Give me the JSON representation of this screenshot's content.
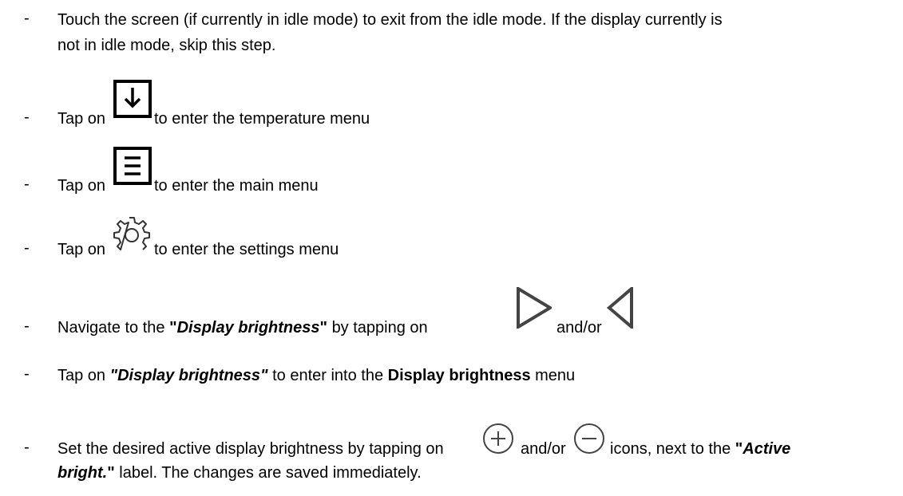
{
  "bullet": "-",
  "step1": {
    "line1": "Touch the screen (if currently in idle mode) to exit from the idle mode. If the display currently is",
    "line2": "not in idle mode, skip this step."
  },
  "step2": {
    "prefix": "Tap on",
    "suffix": "to enter the temperature menu",
    "icon": "arrow-down-box-icon"
  },
  "step3": {
    "prefix": "Tap on",
    "suffix": "to enter the main menu",
    "icon": "menu-box-icon"
  },
  "step4": {
    "prefix": "Tap on",
    "suffix": "to enter the settings menu",
    "icon": "gear-icon"
  },
  "step5": {
    "prefix": "Navigate to the",
    "quote_open": "\"",
    "emph": "Display brightness",
    "quote_close": "\"",
    "middle": "by tapping on",
    "and_or": "and/or",
    "icon_next": "triangle-right-icon",
    "icon_prev": "triangle-left-icon"
  },
  "step6": {
    "prefix": "Tap on",
    "emph": "\"Display brightness\"",
    "middle": "to enter into the",
    "bold": "Display brightness",
    "suffix": "menu"
  },
  "step7": {
    "prefix": "Set the desired active display brightness by tapping on",
    "and_or": "and/or",
    "after": "icons, next to the",
    "quote_open": "\"",
    "emph1": "Active",
    "emph2": "bright.",
    "quote_close": "\"",
    "line2_suffix": "label. The changes are saved immediately.",
    "icon_plus": "plus-circle-icon",
    "icon_minus": "minus-circle-icon"
  }
}
